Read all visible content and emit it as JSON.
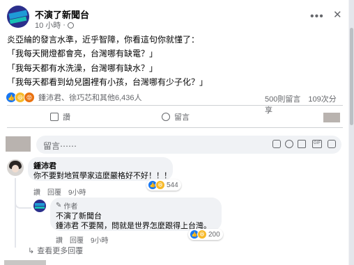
{
  "post": {
    "page_name": "不演了新聞台",
    "time": "10 小時",
    "lines": [
      "炎亞綸的發言水準，近乎智障，你看這句你就懂了：",
      "「我每天開燈都會亮，台灣哪有缺電？」",
      "「我每天都有水洗澡，台灣哪有缺水？」",
      "「我每天都看到幼兒園裡有小孩，台灣哪有少子化？」"
    ],
    "reaction_names": "鍾沛君、徐巧芯和其他6,436人",
    "comments_count": "500則留言",
    "shares_count": "109次分享"
  },
  "actions": {
    "like": "讚",
    "comment": "留言"
  },
  "comment_box": {
    "placeholder": "留言⋯⋯"
  },
  "comments": [
    {
      "name": "鍾沛君",
      "text": "你不要對地質學家這麼嚴格好不好！！！",
      "like_label": "讚",
      "reply_label": "回覆",
      "time": "9小時",
      "reactions": "544"
    }
  ],
  "reply": {
    "author_tag": "作者",
    "name": "不演了新聞台",
    "text": "鍾沛君 不要鬧，問就是世界怎麼跟得上台灣。",
    "like_label": "讚",
    "reply_label": "回覆",
    "time": "9小時",
    "reactions": "200"
  },
  "see_more": "查看更多回覆",
  "colors": {
    "like": "#1877f2",
    "haha": "#f7b928",
    "angry": "#e9710f",
    "page_avatar": "#2b2f8c"
  }
}
